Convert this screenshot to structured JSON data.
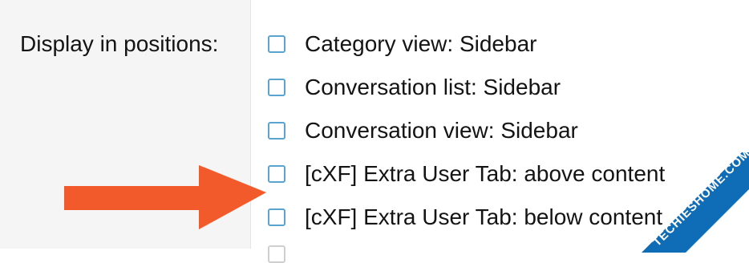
{
  "form": {
    "label": "Display in positions:",
    "options": [
      {
        "label": "Category view: Sidebar",
        "checked": false
      },
      {
        "label": "Conversation list: Sidebar",
        "checked": false
      },
      {
        "label": "Conversation view: Sidebar",
        "checked": false
      },
      {
        "label": "[cXF] Extra User Tab: above content",
        "checked": false
      },
      {
        "label": "[cXF] Extra User Tab: below content",
        "checked": false
      }
    ]
  },
  "annotation": {
    "arrow_color": "#f25a2c"
  },
  "watermark": {
    "text": "TECHIESHOME.COM",
    "color": "#0f6cb6"
  }
}
